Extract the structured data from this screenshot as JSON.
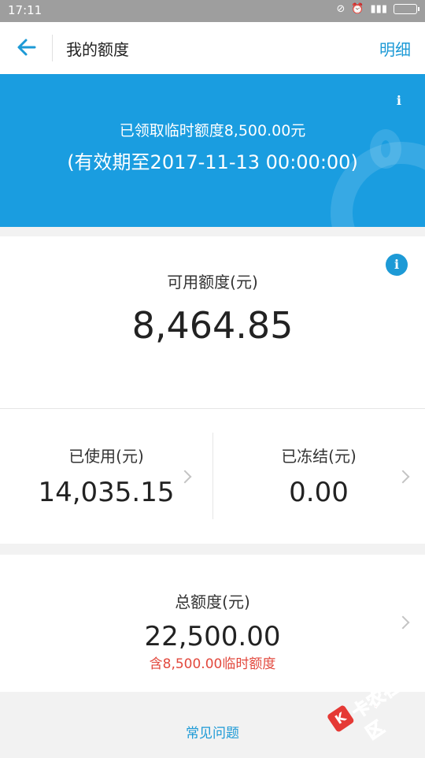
{
  "status_bar": {
    "time": "17:11"
  },
  "nav": {
    "title": "我的额度",
    "detail": "明细"
  },
  "banner": {
    "line1": "已领取临时额度8,500.00元",
    "line2": "(有效期至2017-11-13 00:00:00)",
    "info_glyph": "i"
  },
  "available": {
    "label": "可用额度(元)",
    "value": "8,464.85",
    "info_glyph": "i"
  },
  "used": {
    "label": "已使用(元)",
    "value": "14,035.15"
  },
  "frozen": {
    "label": "已冻结(元)",
    "value": "0.00"
  },
  "total": {
    "label": "总额度(元)",
    "value": "22,500.00",
    "note": "含8,500.00临时额度"
  },
  "footer": {
    "faq": "常见问题"
  },
  "watermark": {
    "text": "卡农社区",
    "mark": "K"
  },
  "colors": {
    "accent": "#1d9ad6",
    "banner": "#1a9de0",
    "warn": "#e2483d"
  }
}
